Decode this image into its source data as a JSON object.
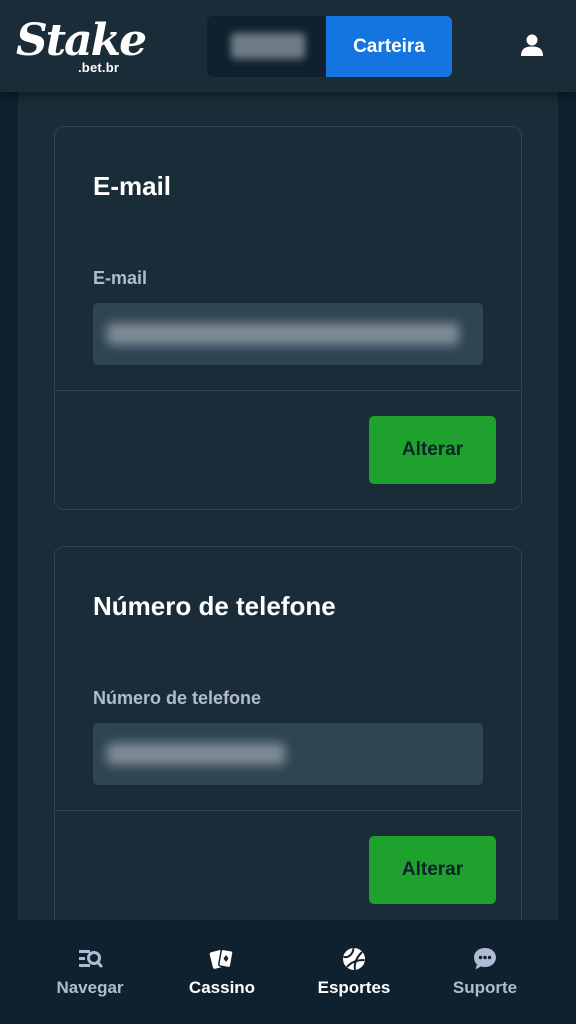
{
  "header": {
    "logo_text": "Stake",
    "logo_domain": ".bet.br",
    "wallet_label": "Carteira",
    "icons": {
      "user": "user-icon"
    }
  },
  "email_section": {
    "title": "E-mail",
    "field_label": "E-mail",
    "button_label": "Alterar"
  },
  "phone_section": {
    "title": "Número de telefone",
    "field_label": "Número de telefone",
    "button_label": "Alterar"
  },
  "bottom_nav": {
    "items": [
      {
        "label": "Navegar",
        "icon": "browse-icon"
      },
      {
        "label": "Cassino",
        "icon": "cards-icon"
      },
      {
        "label": "Esportes",
        "icon": "basketball-icon"
      },
      {
        "label": "Suporte",
        "icon": "chat-icon"
      }
    ]
  },
  "colors": {
    "background": "#0f212e",
    "panel": "#1a2c38",
    "input": "#2f4553",
    "wallet_blue": "#1475e1",
    "button_green": "#1fa12e",
    "label_gray": "#b1bad3"
  }
}
